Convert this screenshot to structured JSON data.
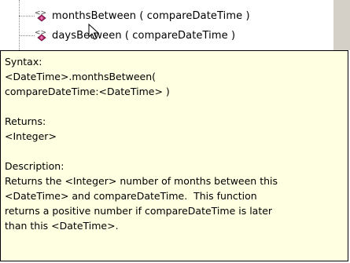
{
  "tree": {
    "items": [
      {
        "label": "monthsBetween ( compareDateTime )",
        "icon": "method-icon"
      },
      {
        "label": "daysBetween ( compareDateTime )",
        "icon": "method-icon"
      }
    ]
  },
  "tooltip": {
    "syntax_heading": "Syntax:",
    "syntax_line1": "<DateTime>.monthsBetween(",
    "syntax_line2": "compareDateTime:<DateTime> )",
    "returns_heading": "Returns:",
    "returns_value": "<Integer>",
    "description_heading": "Description:",
    "description_line1": "Returns the <Integer> number of months between this",
    "description_line2": "<DateTime> and compareDateTime.  This function",
    "description_line3": "returns a positive number if compareDateTime is later",
    "description_line4": "than this <DateTime>."
  },
  "colors": {
    "tooltip_background": "#ffffe1",
    "tooltip_border": "#000000",
    "scrollbar": "#d4d0c8"
  }
}
